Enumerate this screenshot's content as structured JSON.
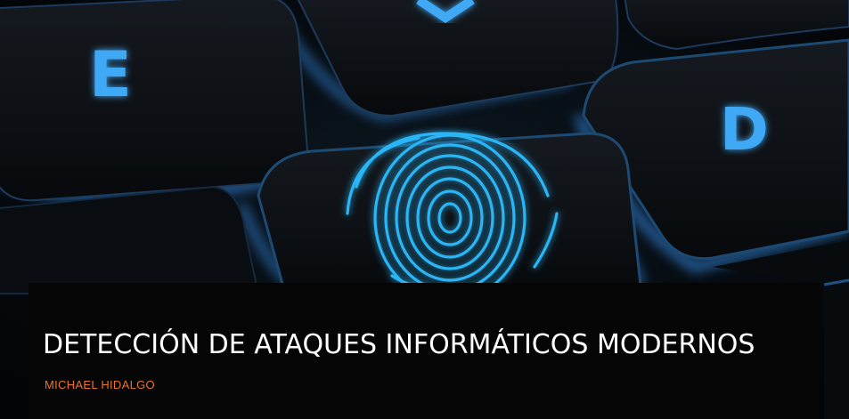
{
  "slide": {
    "title": "DETECCIÓN DE ATAQUES INFORMÁTICOS MODERNOS",
    "author": "MICHAEL HIDALGO"
  },
  "background": {
    "description_icons": [
      "keyboard-key-e-icon",
      "keyboard-key-d-icon",
      "fingerprint-icon"
    ],
    "key_letters": [
      "E",
      "D"
    ]
  },
  "colors": {
    "key_glow": "#3fa9f5",
    "fingerprint": "#29b6f6",
    "title_text": "#ffffff",
    "author_text": "#e8742a",
    "title_bar": "#050505"
  }
}
